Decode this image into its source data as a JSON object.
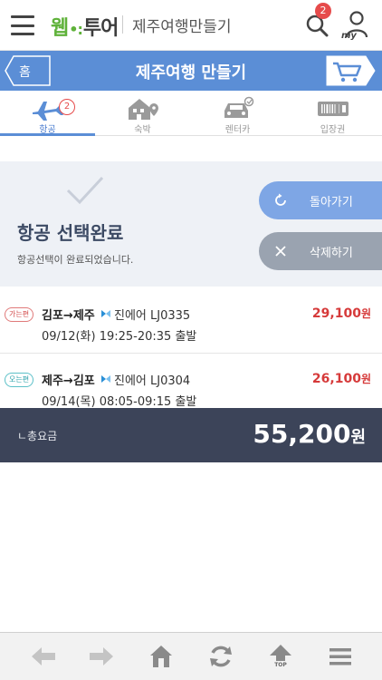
{
  "header": {
    "logo_prefix": "웹",
    "logo_suffix": "투어",
    "app_title": "제주여행만들기",
    "my_label": "my"
  },
  "nav": {
    "home_label": "홈",
    "page_title": "제주여행 만들기",
    "cart_count": "2"
  },
  "tabs": [
    {
      "label": "항공",
      "badge": "2",
      "active": true,
      "icon": "airplane-icon"
    },
    {
      "label": "숙박",
      "active": false,
      "icon": "house-icon"
    },
    {
      "label": "렌터카",
      "active": false,
      "icon": "car-icon"
    },
    {
      "label": "입장권",
      "active": false,
      "icon": "ticket-icon"
    }
  ],
  "status": {
    "title": "항공 선택완료",
    "subtitle": "항공선택이 완료되었습니다.",
    "back_label": "돌아가기",
    "delete_label": "삭제하기"
  },
  "flights": [
    {
      "direction": "가는편",
      "route": "김포→제주",
      "airline": "진에어 LJ0335",
      "schedule": "09/12(화) 19:25-20:35 출발",
      "price": "29,100",
      "unit": "원"
    },
    {
      "direction": "오는편",
      "route": "제주→김포",
      "airline": "진에어 LJ0304",
      "schedule": "09/14(목) 08:05-09:15 출발",
      "price": "26,100",
      "unit": "원"
    }
  ],
  "total": {
    "label": "ㄴ총요금",
    "value": "55,200",
    "unit": "원"
  },
  "bottom_bar": {
    "top_label": "TOP"
  },
  "colors": {
    "accent_blue": "#5b8ed6",
    "price_red": "#d63a3a",
    "total_bg": "#3c4459",
    "logo_green": "#5fb23a"
  }
}
